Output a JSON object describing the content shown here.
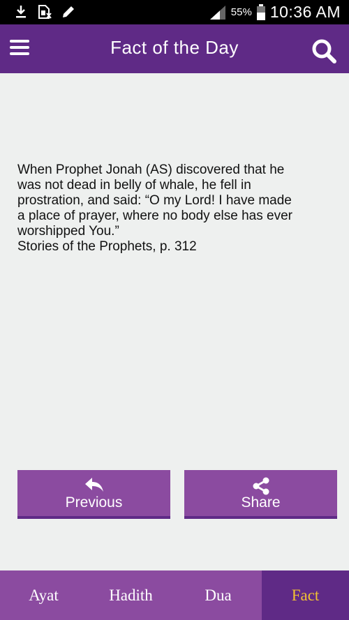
{
  "status_bar": {
    "battery_percent": "55%",
    "time": "10:36 AM"
  },
  "app_bar": {
    "title": "Fact of the Day"
  },
  "fact": {
    "text": "When Prophet Jonah (AS) discovered that he\nwas not dead in belly of whale, he fell in\nprostration, and said: “O my Lord! I have made\na place of prayer, where no body else has ever\nworshipped You.”\nStories of the Prophets, p. 312"
  },
  "actions": {
    "previous_label": "Previous",
    "share_label": "Share"
  },
  "bottom_nav": {
    "tabs": [
      {
        "label": "Ayat"
      },
      {
        "label": "Hadith"
      },
      {
        "label": "Dua"
      },
      {
        "label": "Fact",
        "active": true
      }
    ]
  },
  "colors": {
    "primary": "#5f2a86",
    "secondary": "#8b4ba0",
    "active_tab_text": "#f1c232",
    "background": "#eef0ef"
  }
}
